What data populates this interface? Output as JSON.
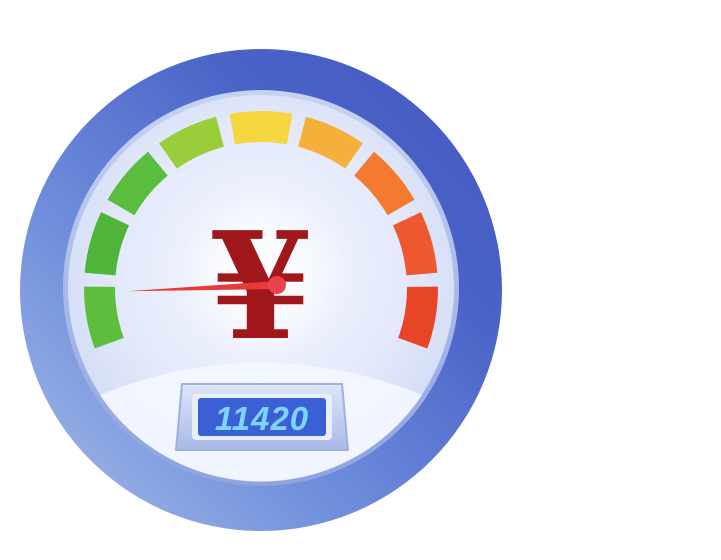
{
  "gauge": {
    "currency_symbol": "¥",
    "odometer_value": "11420",
    "needle_level": 0.08,
    "segment_colors": [
      "#5fbd3e",
      "#4fb43a",
      "#5bbd3d",
      "#9acd3a",
      "#f6d640",
      "#f5b03b",
      "#f47a30",
      "#ef5730",
      "#e84428"
    ],
    "colors": {
      "outer_ring": "#4a63c8",
      "dial_face": "#eef2fc",
      "symbol": "#a0181c",
      "needle": "#e83a3a",
      "odometer_screen": "#3b5fd4",
      "odometer_digits": "#7fd3ff"
    }
  }
}
